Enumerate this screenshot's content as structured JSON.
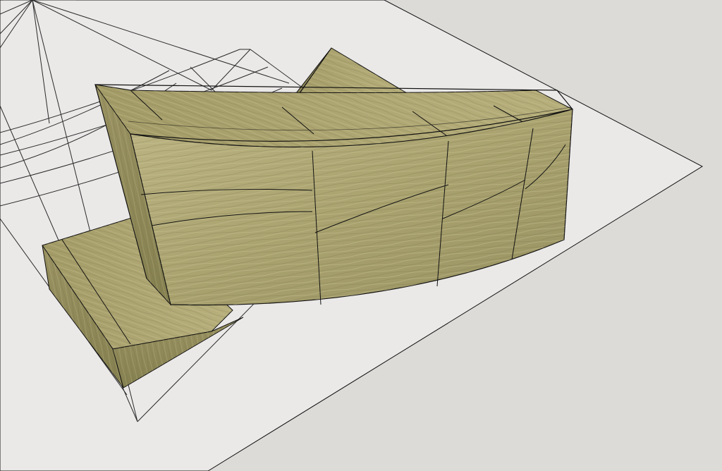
{
  "viewport": {
    "background_color": "#dcdbd8",
    "ground_plane_color": "#ebe9e8",
    "edge_color": "#111111",
    "guide_line_color": "#2a2a2a"
  },
  "model": {
    "material": "wood-grain",
    "wood_base_color": "#a49d6b",
    "wood_light_color": "#c2bb8c",
    "wood_dark_color": "#85804f",
    "wood_grain_color": "#6f6a3f"
  }
}
